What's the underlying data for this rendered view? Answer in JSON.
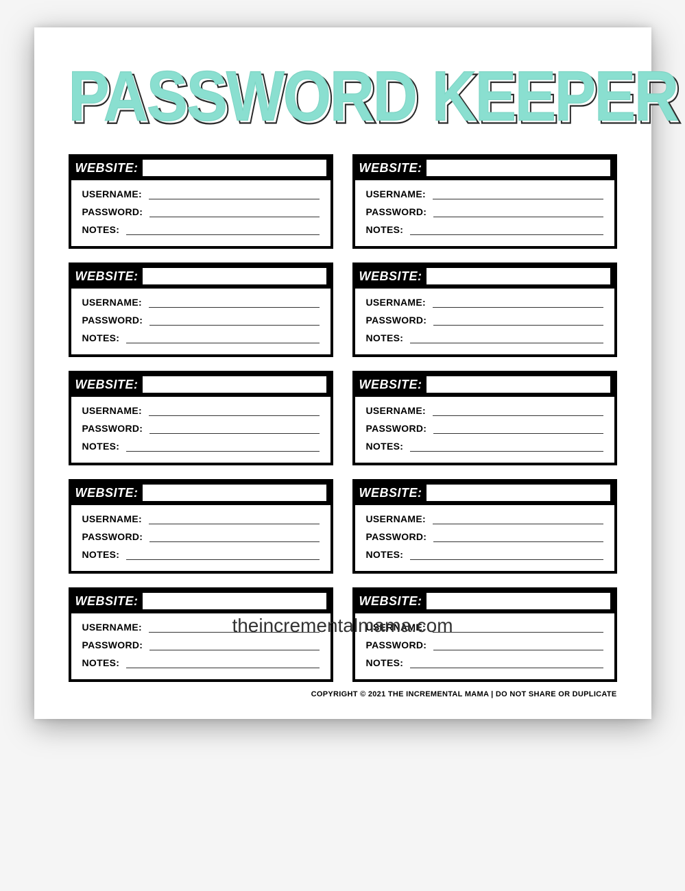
{
  "title": "PASSWORD KEEPER",
  "card": {
    "header_label": "WEBSITE:",
    "fields": {
      "username": "USERNAME:",
      "password": "PASSWORD:",
      "notes": "NOTES:"
    }
  },
  "card_count": 10,
  "copyright": "COPYRIGHT © 2021 THE INCREMENTAL MAMA | DO NOT SHARE OR DUPLICATE",
  "watermark": "theincrementalmama.com"
}
